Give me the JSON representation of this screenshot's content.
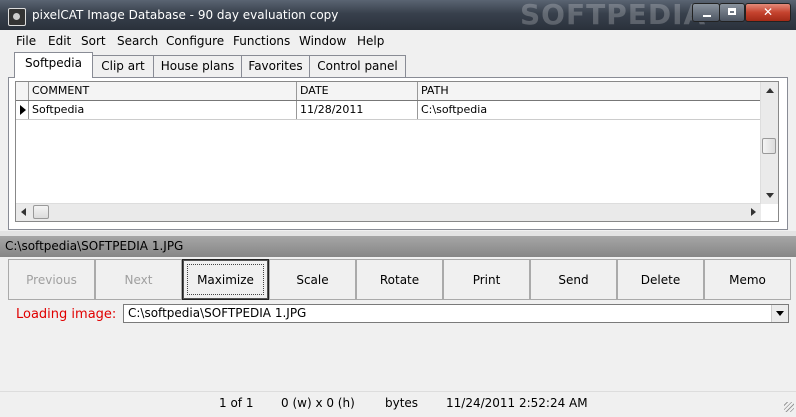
{
  "window": {
    "title": "pixelCAT Image Database - 90 day evaluation copy",
    "watermark": "SOFTPEDIA",
    "colors": {
      "titlebar": "#38404c",
      "close_button": "#c5432e",
      "loading_label": "#e00000",
      "path_bar": "#8f8f8f"
    }
  },
  "menu": [
    {
      "label": "File"
    },
    {
      "label": "Edit"
    },
    {
      "label": "Sort"
    },
    {
      "label": "Search"
    },
    {
      "label": "Configure"
    },
    {
      "label": "Functions"
    },
    {
      "label": "Window"
    },
    {
      "label": "Help"
    }
  ],
  "tabs": [
    {
      "label": "Softpedia",
      "active": true
    },
    {
      "label": "Clip art",
      "active": false
    },
    {
      "label": "House plans",
      "active": false
    },
    {
      "label": "Favorites",
      "active": false
    },
    {
      "label": "Control panel",
      "active": false
    }
  ],
  "grid": {
    "columns": [
      "COMMENT",
      "DATE",
      "PATH"
    ],
    "rows": [
      {
        "comment": "Softpedia",
        "date": "11/28/2011",
        "path": "C:\\softpedia"
      }
    ]
  },
  "path_bar": "C:\\softpedia\\SOFTPEDIA 1.JPG",
  "toolbar": {
    "previous": "Previous",
    "next": "Next",
    "maximize": "Maximize",
    "scale": "Scale",
    "rotate": "Rotate",
    "print": "Print",
    "send": "Send",
    "delete": "Delete",
    "memo": "Memo"
  },
  "loading": {
    "label": "Loading image:",
    "value": "C:\\softpedia\\SOFTPEDIA 1.JPG"
  },
  "status": {
    "position": "1 of 1",
    "dimensions": "0 (w) x 0 (h)",
    "size": "bytes",
    "timestamp": "11/24/2011 2:52:24 AM"
  }
}
